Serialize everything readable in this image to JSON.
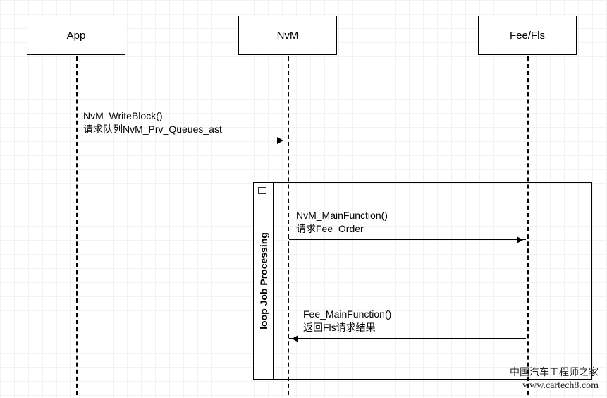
{
  "participants": {
    "app": {
      "label": "App"
    },
    "nvm": {
      "label": "NvM"
    },
    "feefls": {
      "label": "Fee/Fls"
    }
  },
  "messages": {
    "m1": {
      "line1": "NvM_WriteBlock()",
      "line2": "请求队列NvM_Prv_Queues_ast"
    },
    "m2": {
      "line1": "NvM_MainFunction()",
      "line2": "请求Fee_Order"
    },
    "m3": {
      "line1": "Fee_MainFunction()",
      "line2": "返回Fls请求结果"
    }
  },
  "frame": {
    "label": "loop Job Processing"
  },
  "watermark": {
    "line1": "中国汽车工程师之家",
    "line2": "www.cartech8.com"
  }
}
